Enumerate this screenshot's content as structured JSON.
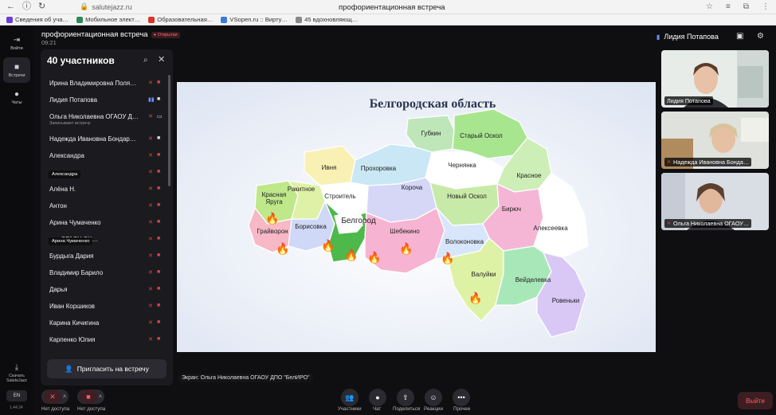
{
  "browser": {
    "url": "salutejazz.ru",
    "page_title": "профориентационная встреча",
    "bookmarks": [
      {
        "label": "Сведения об уча…",
        "color": "#6b3fd6"
      },
      {
        "label": "Мобильное элект…",
        "color": "#2e8b57"
      },
      {
        "label": "Образовательная…",
        "color": "#d9342b"
      },
      {
        "label": "VSopen.ru :: Вирту…",
        "color": "#3b7bd9"
      },
      {
        "label": "45 вдохновляющ…",
        "color": "#888888"
      }
    ]
  },
  "rail": {
    "items": [
      {
        "label": "Войти",
        "icon": "login-icon"
      },
      {
        "label": "Встречи",
        "icon": "video-icon"
      },
      {
        "label": "Чаты",
        "icon": "chat-icon"
      }
    ],
    "download": "Скачать SaluteJazz",
    "lang": "EN",
    "version": "1.44.24"
  },
  "header": {
    "title": "профориентационная встреча",
    "badge": "Открытая",
    "time": "09:21",
    "host": "Лидия Потапова"
  },
  "panel": {
    "title": "40 участников",
    "participants": [
      {
        "name": "Ирина Владимировна Поля…",
        "mic": false,
        "cam": false
      },
      {
        "name": "Лидия Потапова",
        "mic": true,
        "cam": true
      },
      {
        "name": "Ольга Николаевна ОГАОУ Д…",
        "sub": "Записывает встречу",
        "mic": false,
        "cam": "screen"
      },
      {
        "name": "Надежда Ивановна Бондар…",
        "mic": false,
        "cam": true
      },
      {
        "name": "Александра",
        "mic": false,
        "cam": false
      },
      {
        "name": "",
        "mic": false,
        "cam": false
      },
      {
        "name": "Алёна Н.",
        "mic": false,
        "cam": false
      },
      {
        "name": "Антон",
        "mic": false,
        "cam": false
      },
      {
        "name": "Арина Чумаченко",
        "mic": false,
        "cam": false
      },
      {
        "name": "…я ОГАОУ ОК…",
        "mic": false,
        "cam": false
      },
      {
        "name": "Бурдыга Дария",
        "mic": false,
        "cam": false
      },
      {
        "name": "Владимир Барило",
        "mic": false,
        "cam": false
      },
      {
        "name": "Дарья",
        "mic": false,
        "cam": false
      },
      {
        "name": "Иван Коршиков",
        "mic": false,
        "cam": false
      },
      {
        "name": "Карина Кичигина",
        "mic": false,
        "cam": false
      },
      {
        "name": "Карпенко Юлия",
        "mic": false,
        "cam": false
      }
    ],
    "tooltip1": "Александра",
    "tooltip2": "Арина Чумаченко",
    "invite": "Пригласить на встречу"
  },
  "slide": {
    "title": "Белгородская область",
    "districts": [
      {
        "name": "Губкин"
      },
      {
        "name": "Старый Оскол"
      },
      {
        "name": "Ивня"
      },
      {
        "name": "Прохоровка"
      },
      {
        "name": "Чернянка"
      },
      {
        "name": "Красное"
      },
      {
        "name": "Красная"
      },
      {
        "name": "Яруга"
      },
      {
        "name": "Ракитное"
      },
      {
        "name": "Строитель"
      },
      {
        "name": "Короча"
      },
      {
        "name": "Новый Оскол"
      },
      {
        "name": "Бирюч"
      },
      {
        "name": "Белгород"
      },
      {
        "name": "Грайворон"
      },
      {
        "name": "Борисовка"
      },
      {
        "name": "Шебекино"
      },
      {
        "name": "Волоконовка"
      },
      {
        "name": "Алексеевка"
      },
      {
        "name": "Валуйки"
      },
      {
        "name": "Вейделевка"
      },
      {
        "name": "Ровеньки"
      }
    ]
  },
  "screen_caption": "Экран: Ольга Николаевна ОГАОУ ДПО \"БелИРО\"",
  "tiles": [
    {
      "name": "Лидия Потапова"
    },
    {
      "name": "Надежда Ивановна Бонда…"
    },
    {
      "name": "Ольга Николаевна ОГАОУ…"
    }
  ],
  "controls": {
    "mic_label": "Нет доступа",
    "cam_label": "Нет доступа",
    "participants": "Участники",
    "chat": "Чат",
    "share": "Поделиться",
    "reactions": "Реакции",
    "more": "Прочее",
    "leave": "Выйти"
  }
}
